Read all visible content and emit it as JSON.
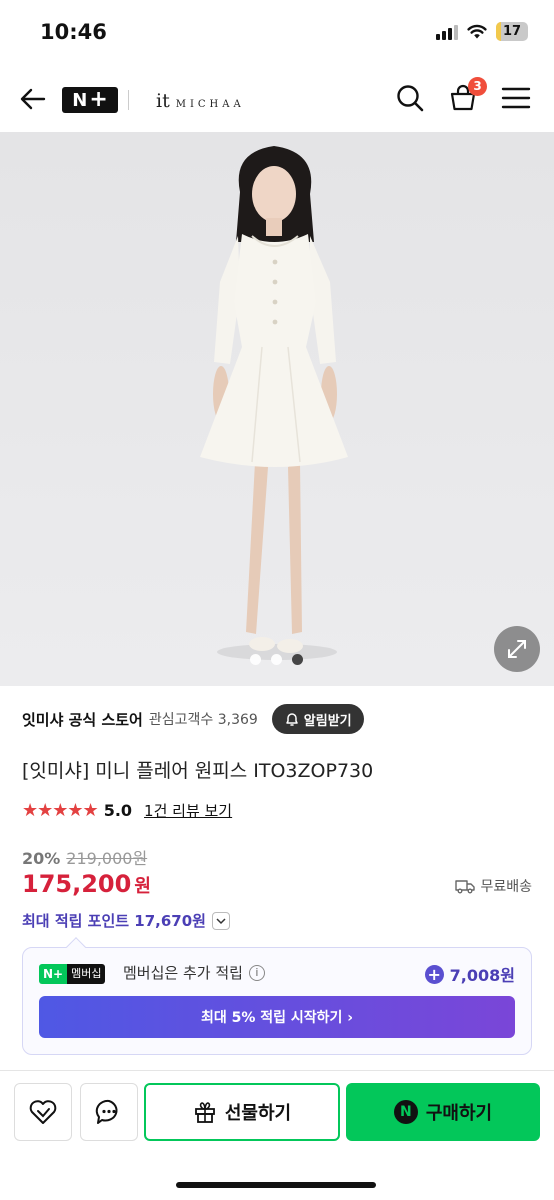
{
  "status": {
    "time": "10:46",
    "battery": "17",
    "battery_fraction": 0.17
  },
  "header": {
    "brand_small": "it",
    "brand_text": "MICHAA",
    "cart_count": "3",
    "accent": "#03c75a"
  },
  "gallery": {
    "image_count": 3,
    "active_index": 2
  },
  "store": {
    "name": "잇미샤 공식 스토어",
    "followers": "관심고객수 3,369",
    "alarm_label": "알림받기"
  },
  "product": {
    "title": "[잇미샤] 미니 플레어 원피스 ITO3ZOP730",
    "stars": "★★★★★",
    "rating": "5.0",
    "review_link": "1건 리뷰 보기",
    "discount": "20%",
    "original_price": "219,000원",
    "price": "175,200",
    "price_unit": "원",
    "price_color": "#d6213b",
    "shipping": "무료배송",
    "points": "최대 적립 포인트 17,670원"
  },
  "membership": {
    "tag_n": "N+",
    "tag_label": "멤버십",
    "text": "멤버십은 추가 적립",
    "amount": "7,008원",
    "button_label": "최대 5% 적립 시작하기 ›"
  },
  "bottom_bar": {
    "gift_label": "선물하기",
    "buy_label": "구매하기",
    "buy_badge": "N"
  }
}
